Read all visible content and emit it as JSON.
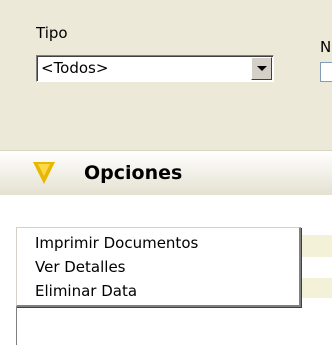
{
  "filters": {
    "tipo_label": "Tipo",
    "tipo_value": "<Todos>",
    "next_label_fragment": "N"
  },
  "options_bar": {
    "title": "Opciones"
  },
  "context_menu": {
    "items": [
      {
        "label": "Imprimir Documentos"
      },
      {
        "label": "Ver Detalles"
      },
      {
        "label": "Eliminar Data"
      }
    ]
  },
  "colors": {
    "panel_background": "#ece9d8",
    "funnel": "#e6b800"
  },
  "icons": [
    "funnel-icon",
    "chevron-down-icon"
  ]
}
